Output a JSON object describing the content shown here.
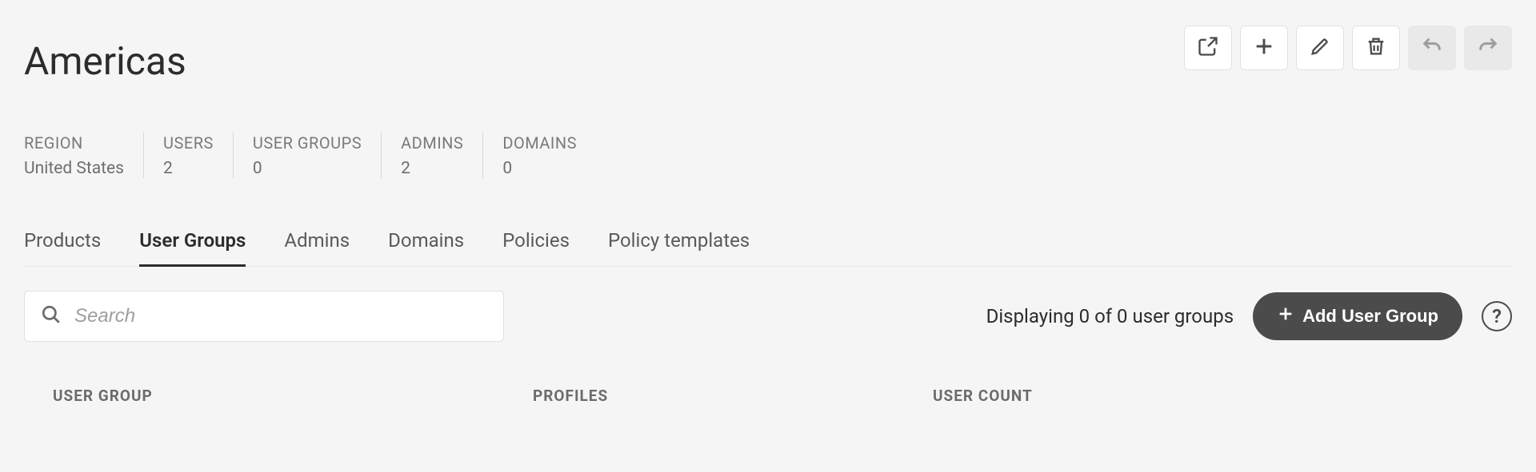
{
  "header": {
    "title": "Americas"
  },
  "toolbar": {
    "export": "Export",
    "add": "Add",
    "edit": "Edit",
    "delete": "Delete",
    "undo": "Undo",
    "redo": "Redo"
  },
  "stats": [
    {
      "label": "REGION",
      "value": "United States"
    },
    {
      "label": "USERS",
      "value": "2"
    },
    {
      "label": "USER GROUPS",
      "value": "0"
    },
    {
      "label": "ADMINS",
      "value": "2"
    },
    {
      "label": "DOMAINS",
      "value": "0"
    }
  ],
  "tabs": [
    {
      "label": "Products",
      "active": false
    },
    {
      "label": "User Groups",
      "active": true
    },
    {
      "label": "Admins",
      "active": false
    },
    {
      "label": "Domains",
      "active": false
    },
    {
      "label": "Policies",
      "active": false
    },
    {
      "label": "Policy templates",
      "active": false
    }
  ],
  "search": {
    "placeholder": "Search",
    "value": ""
  },
  "listing": {
    "display_text": "Displaying 0 of 0 user groups",
    "add_button_label": "Add User Group",
    "help_label": "?"
  },
  "table": {
    "columns": [
      "USER GROUP",
      "PROFILES",
      "USER COUNT"
    ],
    "rows": []
  }
}
